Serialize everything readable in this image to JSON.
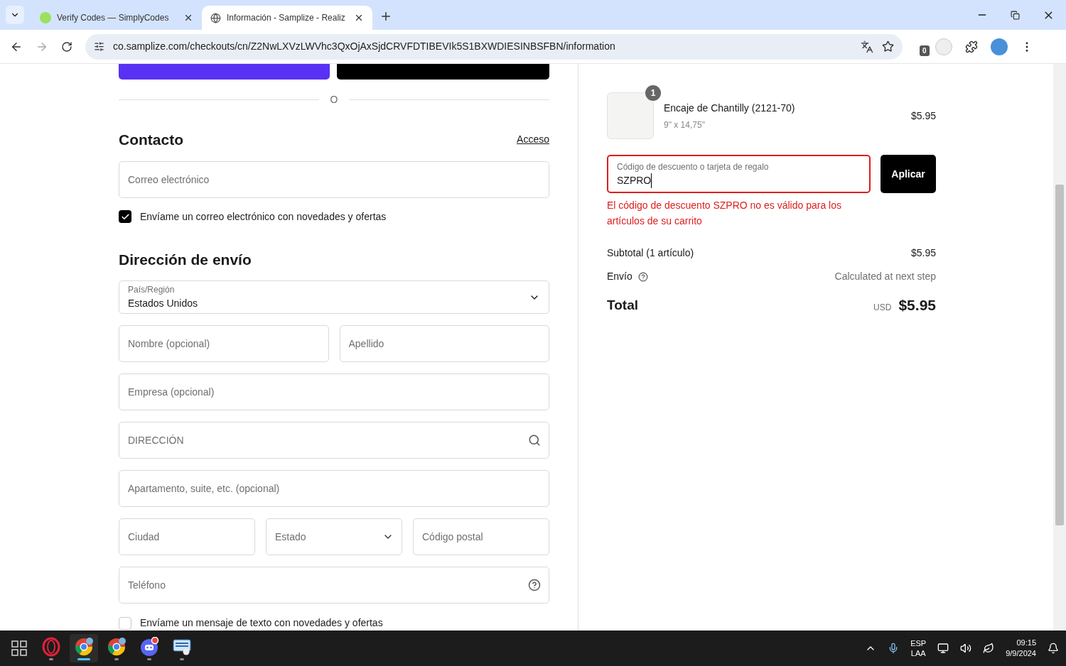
{
  "browser": {
    "tabs": [
      {
        "title": "Verify Codes — SimplyCodes",
        "selected": false
      },
      {
        "title": "Información - Samplize - Realiz",
        "selected": true
      }
    ],
    "url": "co.samplize.com/checkouts/cn/Z2NwLXVzLWVhc3QxOjAxSjdCRVFDTIBEVIk5S1BXWDIESINBSFBN/information",
    "extension_badge": "0"
  },
  "checkout": {
    "divider_label": "O",
    "contact": {
      "title": "Contacto",
      "login_link": "Acceso",
      "email_placeholder": "Correo electrónico",
      "newsletter": {
        "label": "Envíame un correo electrónico con novedades y ofertas",
        "checked": true
      }
    },
    "shipping": {
      "title": "Dirección de envío",
      "country": {
        "label": "País/Región",
        "value": "Estados Unidos"
      },
      "rows": [
        [
          {
            "placeholder": "Nombre (opcional)",
            "kind": "text"
          },
          {
            "placeholder": "Apellido",
            "kind": "text"
          }
        ],
        [
          {
            "placeholder": "Empresa (opcional)",
            "kind": "text"
          }
        ],
        [
          {
            "placeholder": "DIRECCIÓN",
            "kind": "search"
          }
        ],
        [
          {
            "placeholder": "Apartamento, suite, etc. (opcional)",
            "kind": "text"
          }
        ],
        [
          {
            "placeholder": "Ciudad",
            "kind": "text"
          },
          {
            "placeholder": "Estado",
            "kind": "select"
          },
          {
            "placeholder": "Código postal",
            "kind": "text"
          }
        ],
        [
          {
            "placeholder": "Teléfono",
            "kind": "help"
          }
        ]
      ],
      "sms": {
        "label": "Envíame un mensaje de texto con novedades y ofertas",
        "checked": false
      }
    }
  },
  "summary": {
    "item": {
      "quantity": "1",
      "name": "Encaje de Chantilly (2121-70)",
      "variant": "9\" x 14,75\"",
      "price": "$5.95"
    },
    "discount": {
      "label": "Código de descuento o tarjeta de regalo",
      "value": "SZPRO",
      "invalid": true,
      "error": "El código de descuento SZPRO no es válido para los artículos de su carrito"
    },
    "apply_button": "Aplicar",
    "subtotal_label": "Subtotal (1 artículo)",
    "subtotal": "$5.95",
    "shipping_label": "Envío",
    "shipping_value": "Calculated at next step",
    "total_label": "Total",
    "currency": "USD",
    "total": "$5.95"
  },
  "taskbar": {
    "apps": [
      {
        "kind": "opera",
        "selected": false
      },
      {
        "kind": "chrome",
        "selected": true
      },
      {
        "kind": "chrome",
        "selected": false
      },
      {
        "kind": "discord",
        "selected": false
      },
      {
        "kind": "keyboard",
        "selected": false
      }
    ],
    "language": [
      "ESP",
      "LAA"
    ],
    "time": "09:15",
    "date": "9/9/2024"
  }
}
